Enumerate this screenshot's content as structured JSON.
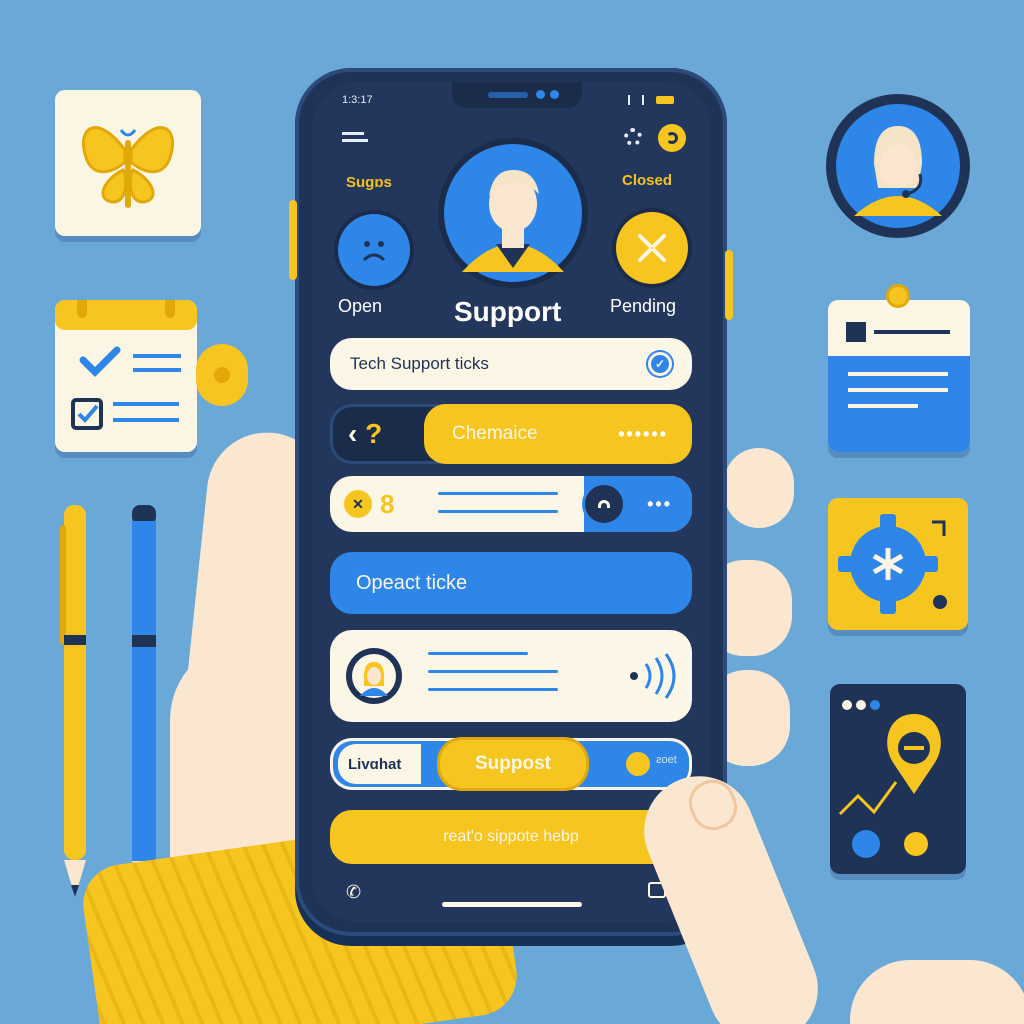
{
  "status": {
    "time": "1:3:17"
  },
  "header": {
    "left_tag": "Suɡɒs",
    "right_tag": "Closed",
    "title": "Support",
    "open_label": "Open",
    "pending_label": "Pending"
  },
  "tickets": {
    "tech_support": "Tech Support ticks",
    "chemaice": "Chemaice",
    "chemaice_prefix": "? ",
    "counter_value": "8",
    "opeact": "Opeact ticke",
    "livechat": "Livɑhat",
    "support_button": "Suppost",
    "small_text": "ƨoet",
    "request_help": "reat'o sippote hebp"
  },
  "colors": {
    "background": "#6aa8d8",
    "phone": "#1f3356",
    "accent_yellow": "#f7c51f",
    "accent_blue": "#2d86e8",
    "cream": "#fbf6e6"
  },
  "icons": [
    "menu-icon",
    "gear-icon",
    "sad-face-icon",
    "tools-icon",
    "avatar-icon",
    "check-icon",
    "sound-waves-icon",
    "phone-icon",
    "clipboard-icon",
    "butterfly-icon",
    "calendar-icon",
    "pen-icon",
    "pencil-icon",
    "headset-agent-icon",
    "notepad-icon",
    "settings-gear-icon",
    "map-pin-icon"
  ]
}
